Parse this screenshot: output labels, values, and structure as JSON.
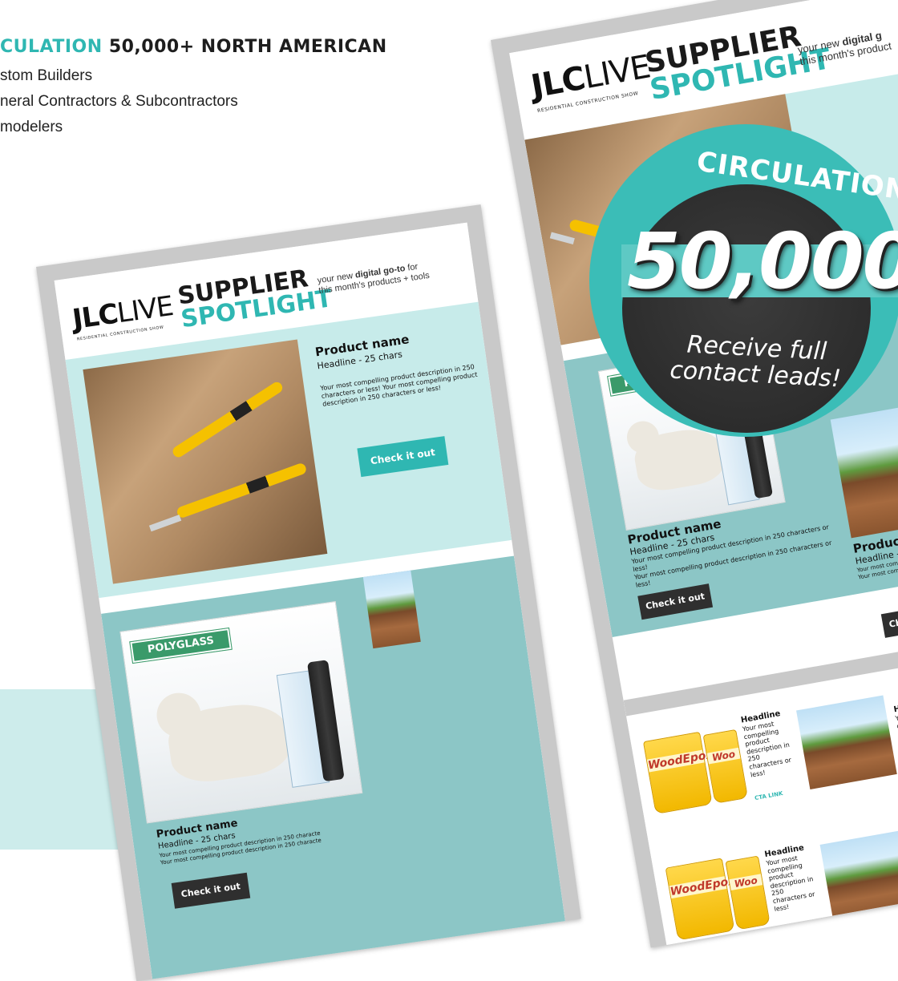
{
  "header": {
    "circulation_label": "CULATION",
    "circulation_rest": " 50,000+ NORTH AMERICAN",
    "audience": [
      "stom Builders",
      "neral Contractors & Subcontractors",
      "modelers"
    ]
  },
  "mockup": {
    "brand": {
      "jlc": "JLC",
      "live": "LIVE",
      "sub": "RESIDENTIAL CONSTRUCTION SHOW"
    },
    "spotlight": {
      "line1": "SUPPLIER",
      "line2": "SPOTLIGHT"
    },
    "tagline": {
      "pre": "your new ",
      "bold": "digital go-to",
      "post": " for",
      "line2": "this month's products + tools"
    },
    "tagline_short": {
      "pre": "your new ",
      "bold": "digital g",
      "line2": "this month's product"
    },
    "product_name": "Product name",
    "headline": "Headline - 25 chars",
    "desc_long": "Your most compelling product description in 250 characters or less! Your most compelling product description in 250 characters or less!",
    "desc_line": "Your most compelling product description in 250 characters or less!",
    "desc_cut": "Your most compelling product description in 250 characte",
    "check_button": "Check it out",
    "polyglass": "POLYGLASS",
    "woodepox": "WoodEpox",
    "woo": "Woo",
    "grid_headline": "Headline",
    "grid_desc": "Your most compelling product description in 250 characters or less!",
    "cta_link": "CTA LINK"
  },
  "badge": {
    "title": "CIRCULATION",
    "number": "50,000",
    "sub1": "Receive full",
    "sub2": "contact leads!"
  },
  "colors": {
    "teal": "#2fb7b2",
    "light_teal": "#c7ebea",
    "mid_teal": "#8cc6c6",
    "dark": "#2f2f2f",
    "frame": "#c9c9c9"
  }
}
